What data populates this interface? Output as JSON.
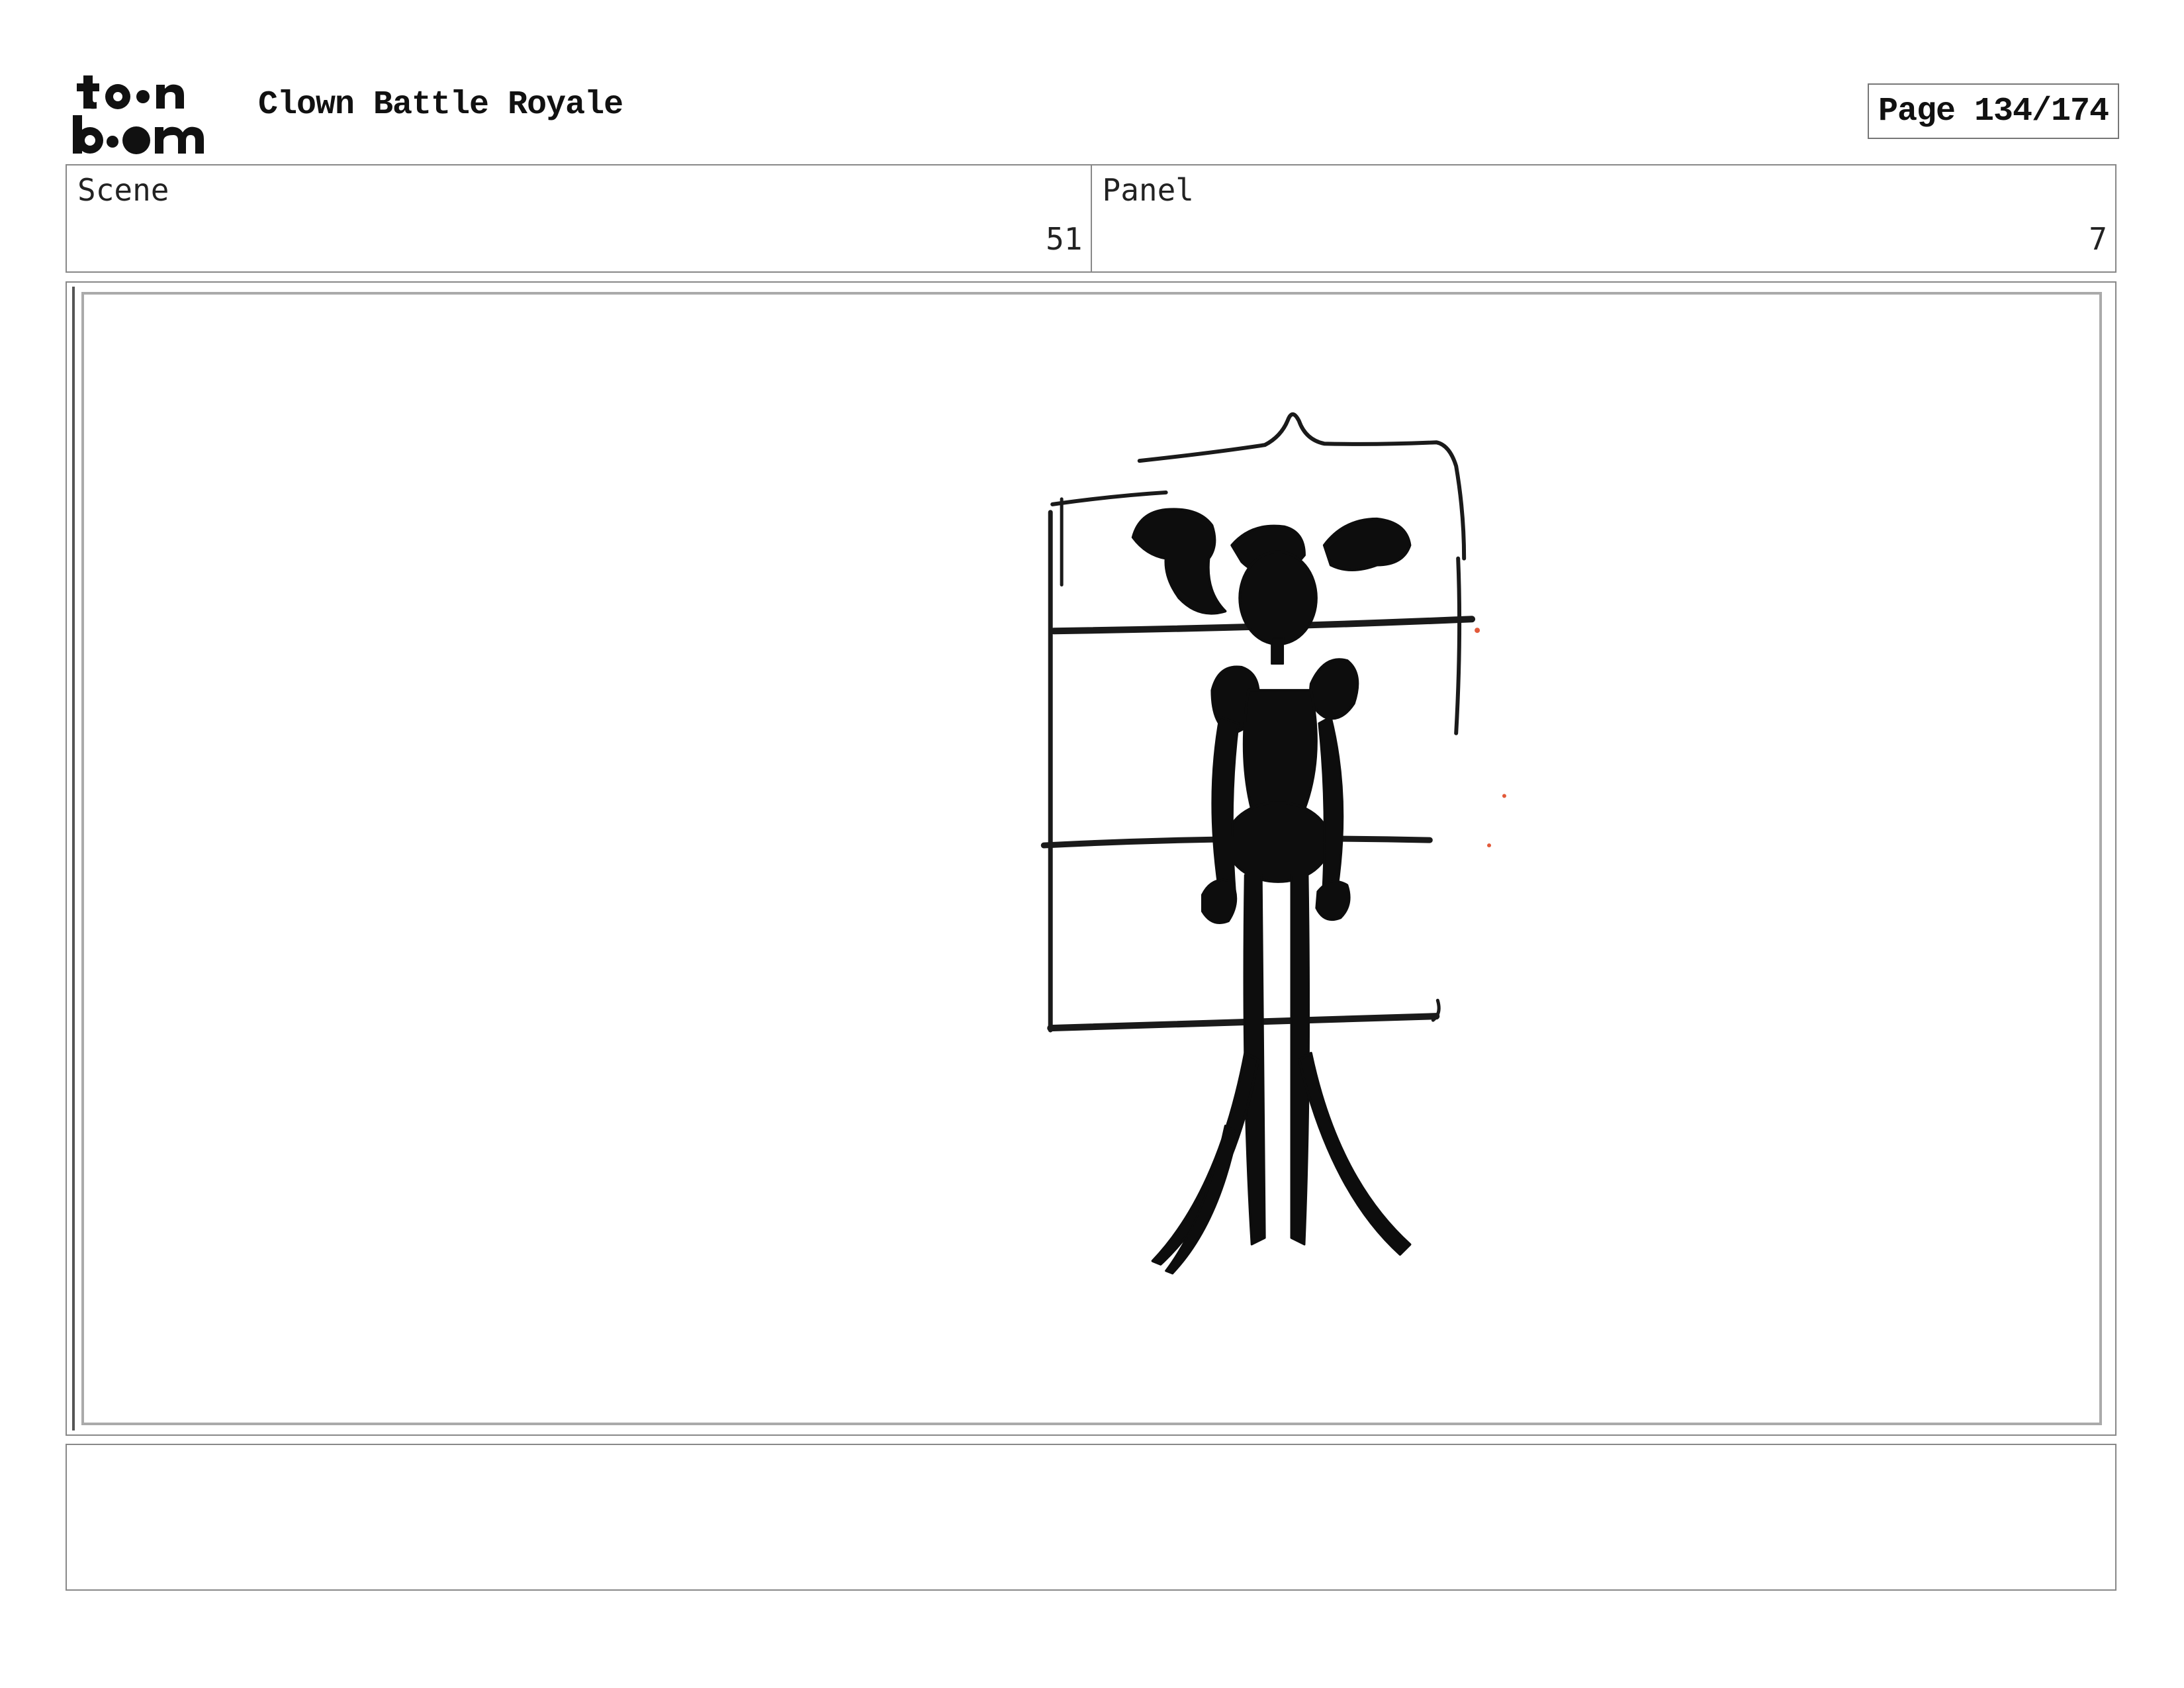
{
  "header": {
    "logo_text": "toon boom",
    "project_title": "Clown Battle Royale",
    "page_indicator": "Page 134/174"
  },
  "info": {
    "scene_label": "Scene",
    "scene_value": "51",
    "panel_label": "Panel",
    "panel_value": "7"
  },
  "panel": {
    "content_icon": "clown-silhouette-sketch"
  },
  "notes": {
    "text": ""
  }
}
